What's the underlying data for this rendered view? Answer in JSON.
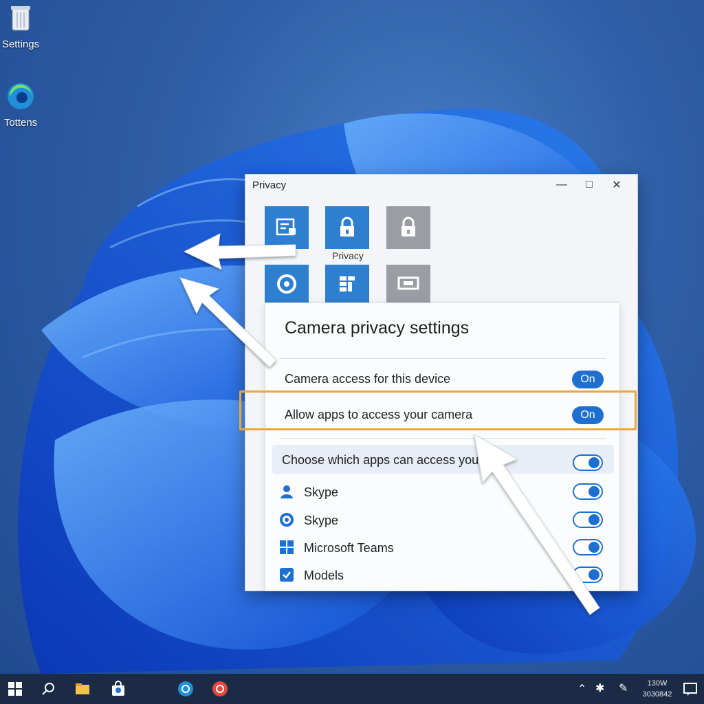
{
  "desktop": {
    "icons": [
      {
        "label": "Settings"
      },
      {
        "label": "Tottens"
      }
    ]
  },
  "window": {
    "title": "Privacy",
    "tile_caption": "Privacy"
  },
  "panel": {
    "heading": "Camera privacy settings",
    "rows": [
      {
        "label": "Camera access for this device",
        "state": "On"
      },
      {
        "label": "Allow apps to access your camera",
        "state": "On"
      }
    ],
    "choose_label": "Choose which apps can access you",
    "apps": [
      {
        "name": "Skype",
        "icon": "person-icon",
        "enabled": true
      },
      {
        "name": "Skype",
        "icon": "skype-ring-icon",
        "enabled": true
      },
      {
        "name": "Microsoft Teams",
        "icon": "windows-grid-icon",
        "enabled": true
      },
      {
        "name": "Models",
        "icon": "check-box-icon",
        "enabled": true
      }
    ]
  },
  "taskbar": {
    "clock_time": "130W",
    "clock_date": "3030842"
  },
  "colors": {
    "accent": "#1f6fd1",
    "highlight": "#e8a83a"
  }
}
